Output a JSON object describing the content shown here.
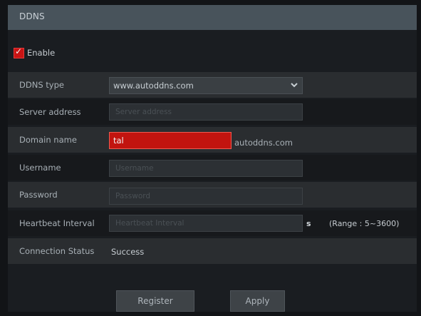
{
  "window": {
    "title": "DDNS"
  },
  "enable": {
    "label": "Enable",
    "checked": true
  },
  "fields": {
    "ddns_type": {
      "label": "DDNS type",
      "value": "www.autoddns.com"
    },
    "server_address": {
      "label": "Server address",
      "placeholder": "Server address"
    },
    "domain_name": {
      "label": "Domain name",
      "value": "tal",
      "suffix": "autoddns.com"
    },
    "username": {
      "label": "Username",
      "placeholder": "Username"
    },
    "password": {
      "label": "Password",
      "placeholder": "Password"
    },
    "heartbeat": {
      "label": "Heartbeat Interval",
      "placeholder": "Heartbeat Interval",
      "unit": "s",
      "range": "(Range : 5~3600)"
    },
    "connection_status": {
      "label": "Connection Status",
      "value": "Success"
    }
  },
  "buttons": {
    "register": "Register",
    "apply": "Apply"
  },
  "colors": {
    "accent": "#c2140f",
    "title_bar": "#48535b",
    "background": "#121417"
  }
}
